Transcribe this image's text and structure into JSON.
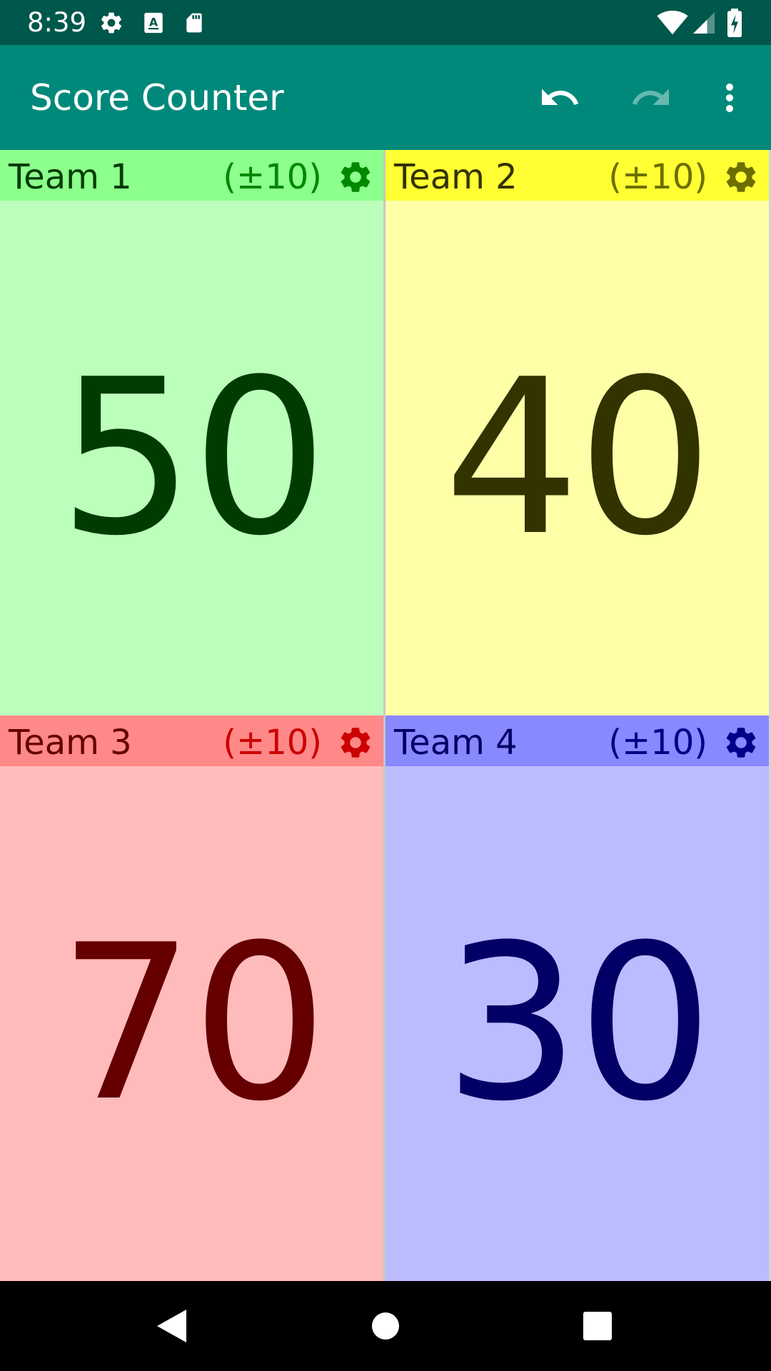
{
  "status_bar": {
    "time": "8:39",
    "icons_left": [
      "settings-icon",
      "text-format-icon",
      "sd-card-icon"
    ],
    "icons_right": [
      "wifi-icon",
      "cell-signal-icon",
      "battery-charging-icon"
    ]
  },
  "app_bar": {
    "title": "Score Counter",
    "actions": [
      "undo-icon",
      "redo-icon",
      "more-vert-icon"
    ]
  },
  "teams": [
    {
      "name": "Team 1",
      "increment": "(±10)",
      "score": "50",
      "header_color": "#8cff8c",
      "body_color": "#bbffbb",
      "accent_color": "#008800",
      "score_color": "#003c00"
    },
    {
      "name": "Team 2",
      "increment": "(±10)",
      "score": "40",
      "header_color": "#ffff33",
      "body_color": "#ffffa8",
      "accent_color": "#6e6e00",
      "score_color": "#333300"
    },
    {
      "name": "Team 3",
      "increment": "(±10)",
      "score": "70",
      "header_color": "#ff8888",
      "body_color": "#ffbbbb",
      "accent_color": "#cc0000",
      "score_color": "#660000"
    },
    {
      "name": "Team 4",
      "increment": "(±10)",
      "score": "30",
      "header_color": "#8888ff",
      "body_color": "#bbbbff",
      "accent_color": "#000088",
      "score_color": "#000066"
    }
  ],
  "nav_bar": {
    "buttons": [
      "back-icon",
      "home-icon",
      "recents-icon"
    ]
  }
}
